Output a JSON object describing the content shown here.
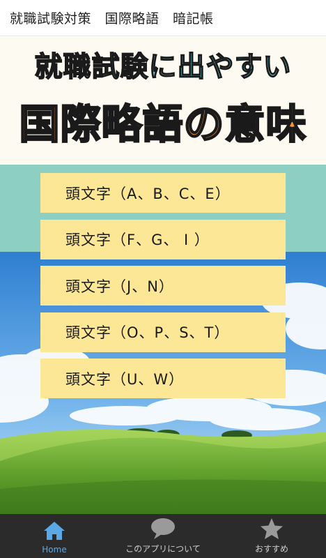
{
  "app_title": "就職試験対策　国際略語　暗記帳",
  "banner": {
    "line1": "就職試験に出やすい",
    "line2": "国際略語の意味"
  },
  "menu": {
    "items": [
      {
        "label": "頭文字（A、B、C、E）"
      },
      {
        "label": "頭文字（F、G、 I ）"
      },
      {
        "label": "頭文字（J、N）"
      },
      {
        "label": "頭文字（O、P、S、T）"
      },
      {
        "label": "頭文字（U、W）"
      }
    ]
  },
  "bottom_nav": {
    "tabs": [
      {
        "label": "Home",
        "icon": "home-icon",
        "active": true
      },
      {
        "label": "このアプリについて",
        "icon": "speech-bubble-icon",
        "active": false
      },
      {
        "label": "おすすめ",
        "icon": "star-icon",
        "active": false
      }
    ]
  },
  "colors": {
    "menu_item": "#fbe795",
    "background_teal": "#8ecfc4",
    "nav_bar": "#2b2b2b",
    "active_tab": "#5aa9e6",
    "banner_line1": "#6fd4e0",
    "banner_line2": "#f6923a"
  }
}
